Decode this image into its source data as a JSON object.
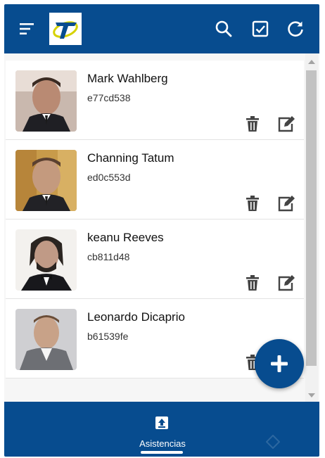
{
  "colors": {
    "primary": "#074c8f",
    "card_bg": "#ffffff",
    "text": "#111111"
  },
  "header": {
    "menu_icon": "menu-icon",
    "logo_icon": "brand-logo",
    "search_icon": "search-icon",
    "check_icon": "checkbox-icon",
    "refresh_icon": "refresh-icon"
  },
  "people": [
    {
      "name": "Mark Wahlberg",
      "code": "e77cd538"
    },
    {
      "name": "Channing Tatum",
      "code": "ed0c553d"
    },
    {
      "name": "keanu Reeves",
      "code": "cb811d48"
    },
    {
      "name": "Leonardo Dicaprio",
      "code": "b61539fe"
    }
  ],
  "fab": {
    "icon": "plus-icon"
  },
  "bottom_nav": {
    "item_label": "Asistencias",
    "item_icon": "upload-icon"
  }
}
